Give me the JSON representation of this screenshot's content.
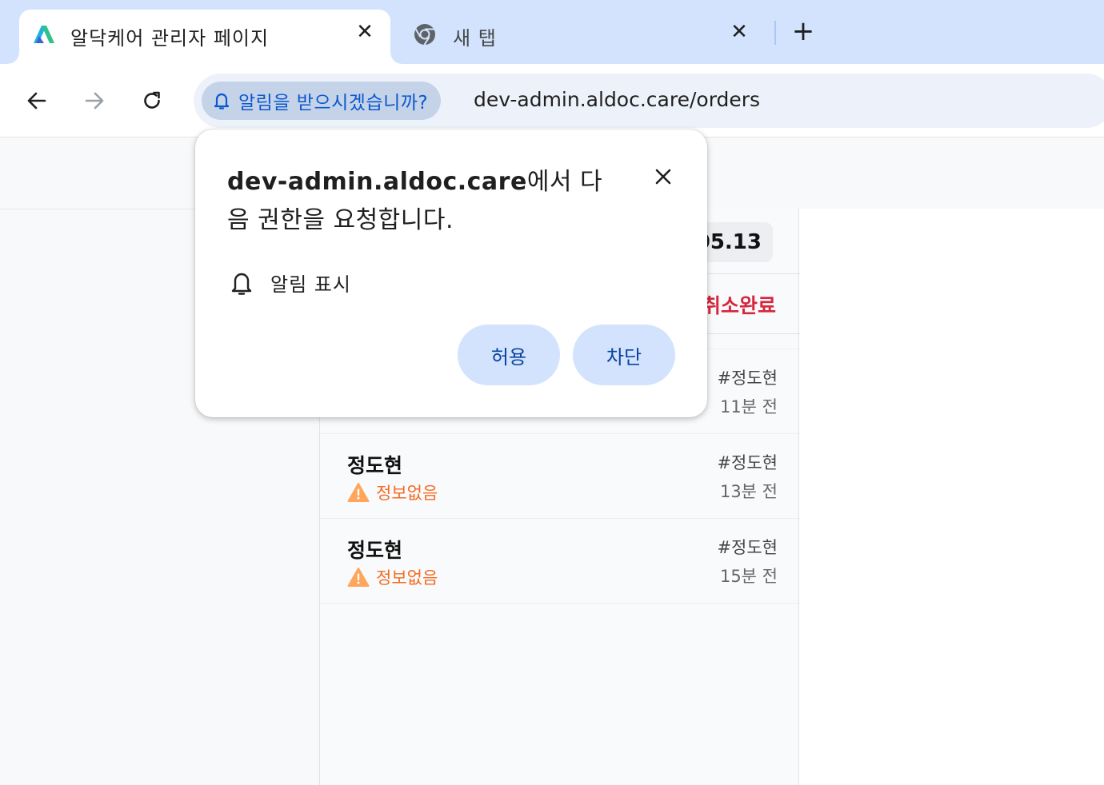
{
  "browser": {
    "tabs": [
      {
        "title": "알닥케어 관리자 페이지",
        "active": true,
        "favicon": "aldoc-logo-icon"
      },
      {
        "title": "새 탭",
        "active": false,
        "favicon": "chrome-icon"
      }
    ],
    "tab_close_glyph": "✕",
    "new_tab_glyph": "+",
    "permission_chip": "알림을 받으시겠습니까?",
    "url": "dev-admin.aldoc.care/orders"
  },
  "dialog": {
    "origin": "dev-admin.aldoc.care",
    "title_rest": "에서 다음 권한을 요청합니다.",
    "permission": "알림 표시",
    "allow_label": "허용",
    "block_label": "차단"
  },
  "orders_panel": {
    "date_fragment": "05.13",
    "cancel_tab_fragment": "취소완료",
    "rows": [
      {
        "name": "",
        "status": "",
        "tag": "#정도현",
        "time": "11분 전"
      },
      {
        "name": "정도현",
        "status": "정보없음",
        "tag": "#정도현",
        "time": "13분 전"
      },
      {
        "name": "정도현",
        "status": "정보없음",
        "tag": "#정도현",
        "time": "15분 전"
      }
    ]
  },
  "colors": {
    "tabstrip": "#d3e3fd",
    "omnibox": "#edf2fa",
    "chip": "#c5d3e8",
    "accent_blue": "#0b57d0",
    "button_bg": "#d3e3fd",
    "cancel_red": "#d7263d",
    "warning_orange": "#f36b21"
  }
}
